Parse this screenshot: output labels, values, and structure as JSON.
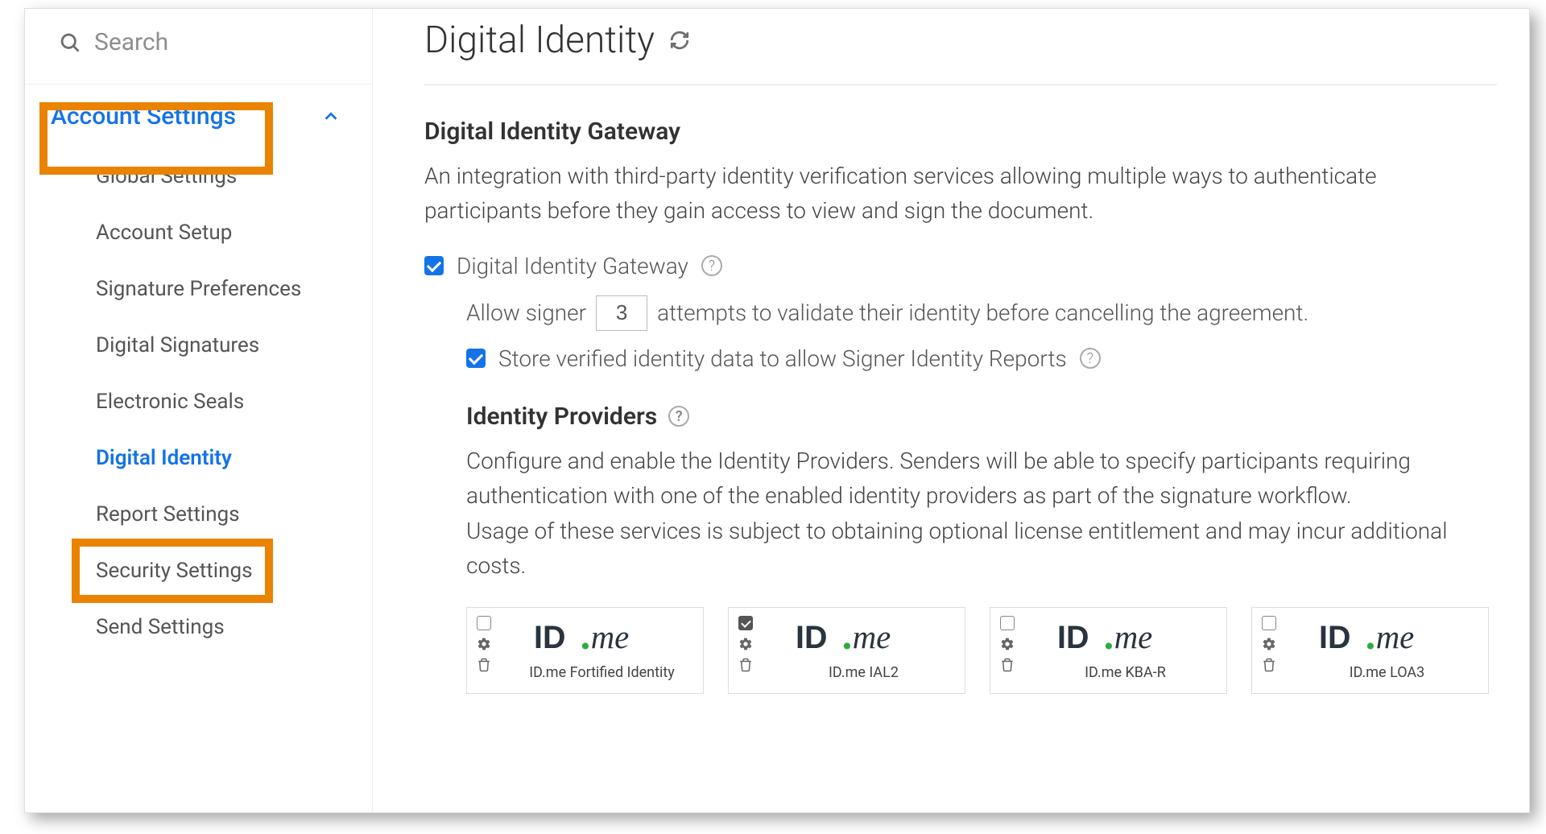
{
  "sidebar": {
    "search_placeholder": "Search",
    "group_label": "Account Settings",
    "items": [
      {
        "label": "Global Settings"
      },
      {
        "label": "Account Setup"
      },
      {
        "label": "Signature Preferences"
      },
      {
        "label": "Digital Signatures"
      },
      {
        "label": "Electronic Seals"
      },
      {
        "label": "Digital Identity"
      },
      {
        "label": "Report Settings"
      },
      {
        "label": "Security Settings"
      },
      {
        "label": "Send Settings"
      }
    ]
  },
  "main": {
    "title": "Digital Identity",
    "gateway": {
      "heading": "Digital Identity Gateway",
      "description": "An integration with third-party identity verification services allowing multiple ways to authenticate participants before they gain access to view and sign the document.",
      "enable_label": "Digital Identity Gateway",
      "enable_checked": true,
      "attempts_pre": "Allow signer",
      "attempts_value": "3",
      "attempts_post": "attempts to validate their identity before cancelling the agreement.",
      "store_label": "Store verified identity data to allow Signer Identity Reports",
      "store_checked": true
    },
    "providers": {
      "heading": "Identity Providers",
      "description": "Configure and enable the Identity Providers. Senders will be able to specify participants requiring authentication with one of the enabled identity providers as part of the signature workflow.\nUsage of these services is subject to obtaining optional license entitlement and may incur additional costs.",
      "cards": [
        {
          "caption": "ID.me Fortified Identity",
          "checked": false
        },
        {
          "caption": "ID.me IAL2",
          "checked": true
        },
        {
          "caption": "ID.me KBA-R",
          "checked": false
        },
        {
          "caption": "ID.me LOA3",
          "checked": false
        }
      ]
    }
  }
}
